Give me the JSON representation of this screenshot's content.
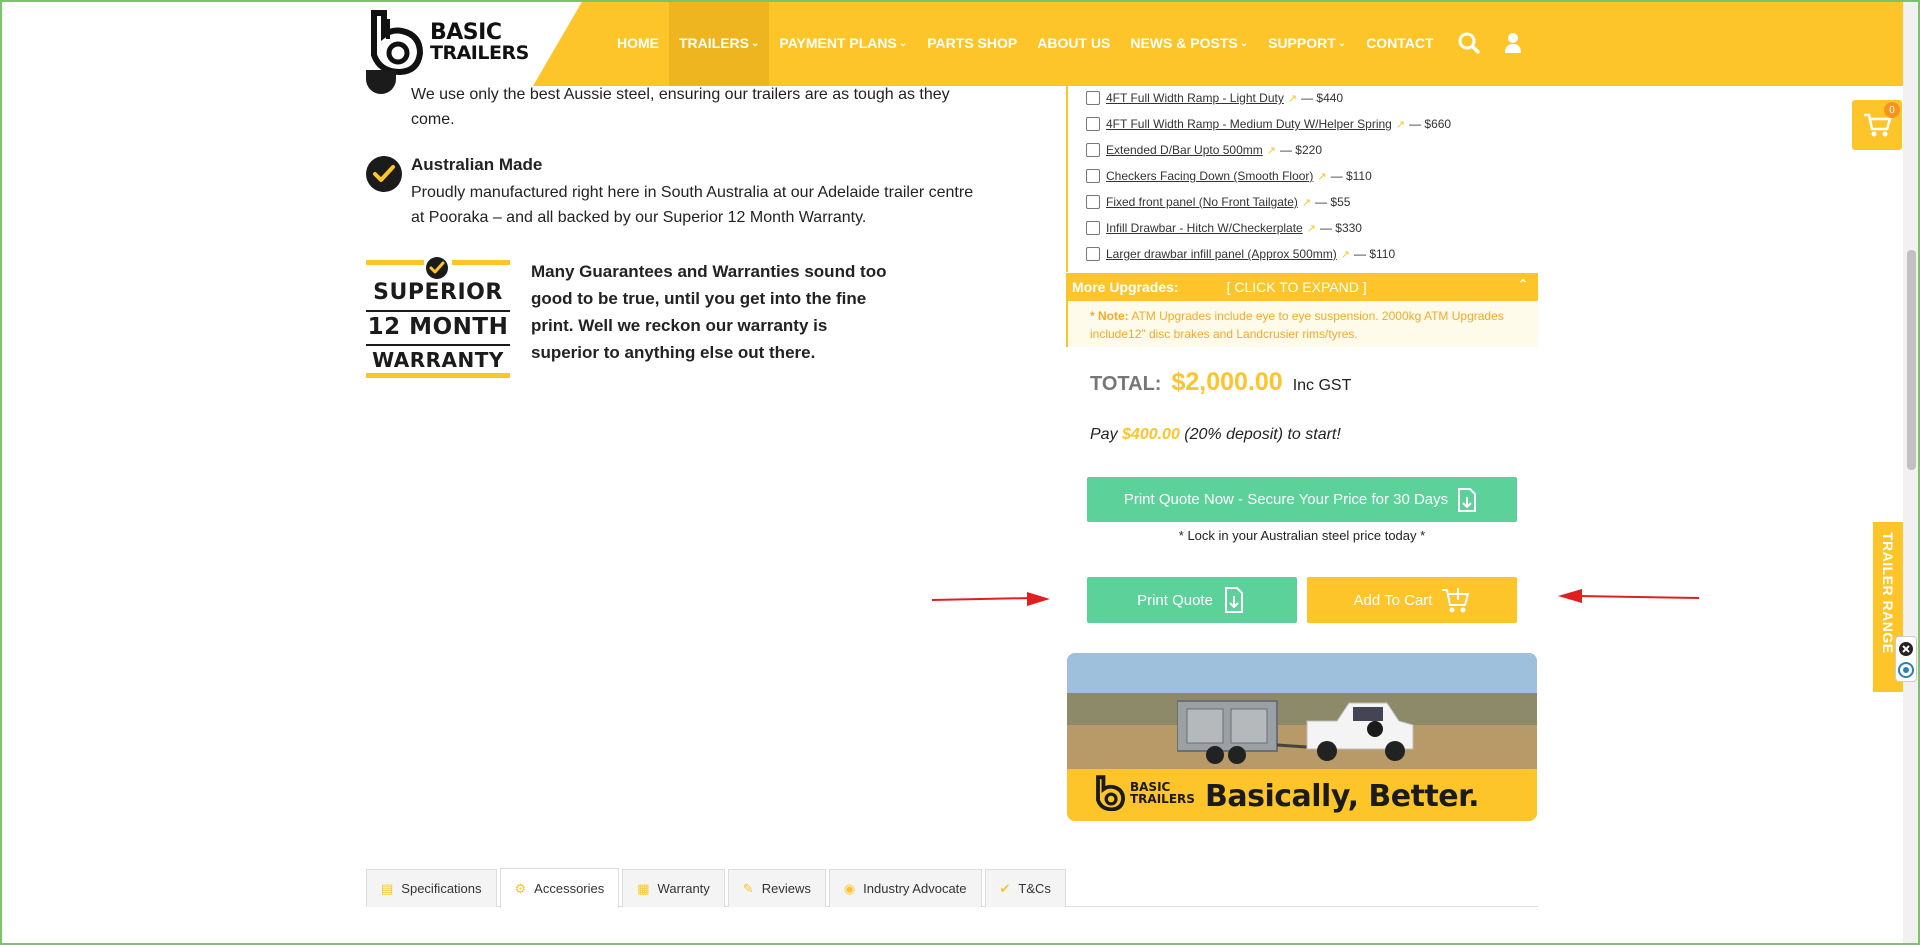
{
  "header": {
    "logo_line1": "BASIC",
    "logo_line2": "TRAILERS",
    "nav": [
      {
        "label": "HOME",
        "caret": ""
      },
      {
        "label": "TRAILERS",
        "caret": "⌄"
      },
      {
        "label": "PAYMENT PLANS",
        "caret": "⌄"
      },
      {
        "label": "PARTS SHOP",
        "caret": ""
      },
      {
        "label": "ABOUT US",
        "caret": ""
      },
      {
        "label": "NEWS & POSTS",
        "caret": "⌄"
      },
      {
        "label": "SUPPORT",
        "caret": "⌄"
      },
      {
        "label": "CONTACT",
        "caret": ""
      }
    ]
  },
  "cart": {
    "count": "0"
  },
  "side_tab": {
    "label": "TRAILER RANGE"
  },
  "features": {
    "steel_text": "We use only the best Aussie steel, ensuring our trailers are as tough as they come.",
    "made_title": "Australian Made",
    "made_text": "Proudly manufactured right here in South Australia at our Adelaide trailer centre at Pooraka – and all backed by our Superior 12 Month Warranty."
  },
  "warranty": {
    "badge_line1": "SUPERIOR",
    "badge_line2": "12 MONTH",
    "badge_line3": "WARRANTY",
    "copy": "Many Guarantees and Warranties sound too good to be true, until you get into the fine print. Well we reckon our warranty is superior to anything else out there."
  },
  "accessories": [
    {
      "name": "4FT Full Width Ramp - Light Duty",
      "price": "— $440"
    },
    {
      "name": "4FT Full Width Ramp - Medium Duty W/Helper Spring",
      "price": "— $660"
    },
    {
      "name": "Extended D/Bar Upto 500mm",
      "price": "— $220"
    },
    {
      "name": "Checkers Facing Down (Smooth Floor)",
      "price": "— $110"
    },
    {
      "name": "Fixed front panel (No Front Tailgate)",
      "price": "— $55"
    },
    {
      "name": "Infill Drawbar - Hitch W/Checkerplate",
      "price": "— $330"
    },
    {
      "name": "Larger drawbar infill panel (Approx 500mm)",
      "price": "— $110"
    }
  ],
  "more_upgrades": {
    "label": "More Upgrades:",
    "expand": "[ CLICK TO EXPAND ]"
  },
  "note": {
    "prefix": "* Note:",
    "text": " ATM Upgrades include eye to eye suspension. 2000kg ATM Upgrades include12\" disc brakes and Landcrusier rims/tyres."
  },
  "total": {
    "label": "TOTAL:",
    "value": "$2,000.00",
    "gst": "Inc GST"
  },
  "deposit": {
    "pay": "Pay ",
    "amount": "$400.00",
    "rest": " (20% deposit) to start!"
  },
  "buttons": {
    "print_quote_now": "Print Quote Now - Secure Your Price for 30 Days",
    "lock_note": "* Lock in your Australian steel price today *",
    "print_quote": "Print Quote",
    "add_to_cart": "Add To Cart"
  },
  "banner": {
    "logo1": "BASIC",
    "logo2": "TRAILERS",
    "slogan": "Basically, Better."
  },
  "tabs": [
    {
      "label": "Specifications",
      "icon": "▤",
      "active": false
    },
    {
      "label": "Accessories",
      "icon": "⚙",
      "active": true
    },
    {
      "label": "Warranty",
      "icon": "▦",
      "active": false
    },
    {
      "label": "Reviews",
      "icon": "✎",
      "active": false
    },
    {
      "label": "Industry Advocate",
      "icon": "◉",
      "active": false
    },
    {
      "label": "T&Cs",
      "icon": "✔",
      "active": false
    }
  ],
  "colors": {
    "brand_yellow": "#fdc52a",
    "green": "#5cd29a",
    "arrow_red": "#e02020"
  }
}
